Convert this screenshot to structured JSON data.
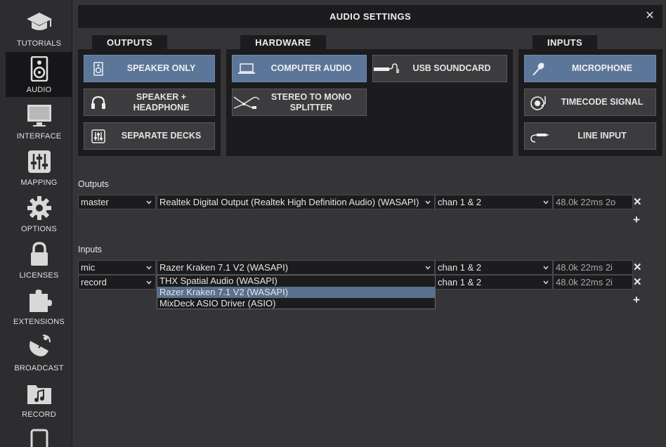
{
  "sidebar": {
    "items": [
      {
        "label": "TUTORIALS",
        "icon": "graduation-cap-icon"
      },
      {
        "label": "AUDIO",
        "icon": "speaker-icon",
        "active": true
      },
      {
        "label": "INTERFACE",
        "icon": "monitor-icon"
      },
      {
        "label": "MAPPING",
        "icon": "sliders-icon"
      },
      {
        "label": "OPTIONS",
        "icon": "gear-icon"
      },
      {
        "label": "LICENSES",
        "icon": "lock-icon"
      },
      {
        "label": "EXTENSIONS",
        "icon": "puzzle-icon"
      },
      {
        "label": "BROADCAST",
        "icon": "satellite-dish-icon"
      },
      {
        "label": "RECORD",
        "icon": "music-folder-icon"
      },
      {
        "label": "",
        "icon": "phone-icon"
      }
    ]
  },
  "header": {
    "title": "AUDIO SETTINGS",
    "close": "✕"
  },
  "outputs": {
    "tab": "OUTPUTS",
    "buttons": [
      {
        "label": "SPEAKER ONLY",
        "icon": "speaker-icon",
        "active": true
      },
      {
        "label": "SPEAKER + HEADPHONE",
        "icon": "headphones-icon",
        "active": false
      },
      {
        "label": "SEPARATE DECKS",
        "icon": "mixer-icon",
        "active": false
      }
    ]
  },
  "hardware": {
    "tab": "HARDWARE",
    "buttons": [
      {
        "label": "COMPUTER AUDIO",
        "icon": "laptop-icon",
        "active": true
      },
      {
        "label": "USB SOUNDCARD",
        "icon": "usb-cable-icon",
        "active": false
      },
      {
        "label": "STEREO TO MONO SPLITTER",
        "icon": "splitter-cable-icon",
        "active": false
      }
    ]
  },
  "inputs": {
    "tab": "INPUTS",
    "buttons": [
      {
        "label": "MICROPHONE",
        "icon": "microphone-icon",
        "active": true
      },
      {
        "label": "TIMECODE SIGNAL",
        "icon": "turntable-icon",
        "active": false
      },
      {
        "label": "LINE INPUT",
        "icon": "jack-cable-icon",
        "active": false
      }
    ]
  },
  "config": {
    "outputs_label": "Outputs",
    "outputs_rows": [
      {
        "name": "master",
        "device": "Realtek Digital Output (Realtek High Definition Audio) (WASAPI)",
        "channels": "chan 1 & 2",
        "info": "48.0k 22ms 2o"
      }
    ],
    "inputs_label": "Inputs",
    "inputs_rows": [
      {
        "name": "mic",
        "device": "Razer Kraken 7.1 V2 (WASAPI)",
        "channels": "chan 1 & 2",
        "info": "48.0k 22ms 2i"
      },
      {
        "name": "record",
        "device": "",
        "channels": "chan 1 & 2",
        "info": "48.0k 22ms 2i"
      }
    ],
    "device_dropdown": {
      "options": [
        "THX Spatial Audio (WASAPI)",
        "Razer Kraken 7.1 V2 (WASAPI)",
        "MixDeck ASIO Driver (ASIO)"
      ],
      "highlighted": "Razer Kraken 7.1 V2 (WASAPI)"
    },
    "remove_symbol": "✕",
    "add_symbol": "+"
  },
  "colors": {
    "active_button": "#5b7699",
    "panel": "#1c1c1e",
    "background": "#353538"
  }
}
